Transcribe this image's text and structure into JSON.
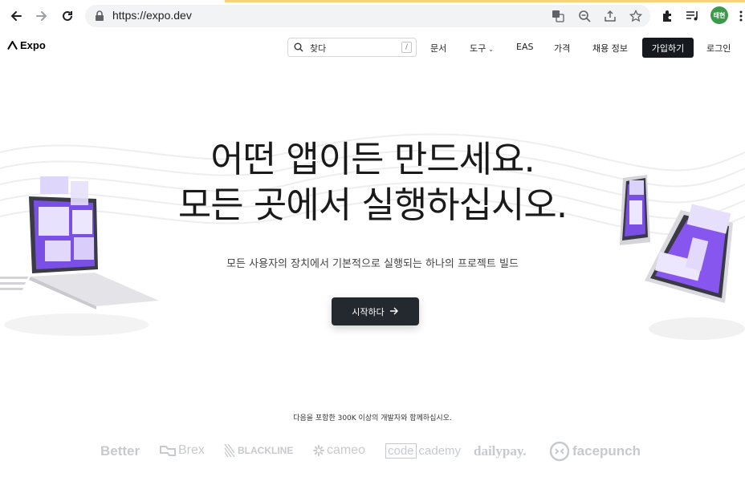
{
  "browser": {
    "url": "https://expo.dev",
    "profile_initials": "태현"
  },
  "header": {
    "logo_text": "Expo",
    "search_placeholder": "찾다",
    "search_shortcut": "/",
    "nav": [
      "문서",
      "도구",
      "EAS",
      "가격",
      "채용 정보"
    ],
    "signup_label": "가입하기",
    "login_label": "로그인"
  },
  "hero": {
    "headline_line1": "어떤 앱이든 만드세요.",
    "headline_line2": "모든 곳에서 실행하십시오.",
    "subtitle": "모든 사용자의 장치에서 기본적으로 실행되는 하나의 프로젝트 빌드",
    "cta_label": "시작하다",
    "trust_text": "다음을 포함한 300K 이상의 개발자와 함께하십시오.",
    "brands": [
      "Better",
      "Brex",
      "BLACKLINE",
      "cameo",
      "code",
      "cademy",
      "dailypay.",
      "facepunch"
    ]
  },
  "colors": {
    "dark_button": "#16191d",
    "cta": "#24292f",
    "accent_purple": "#7b4ff0",
    "brand_gray": "#c7cacd"
  }
}
